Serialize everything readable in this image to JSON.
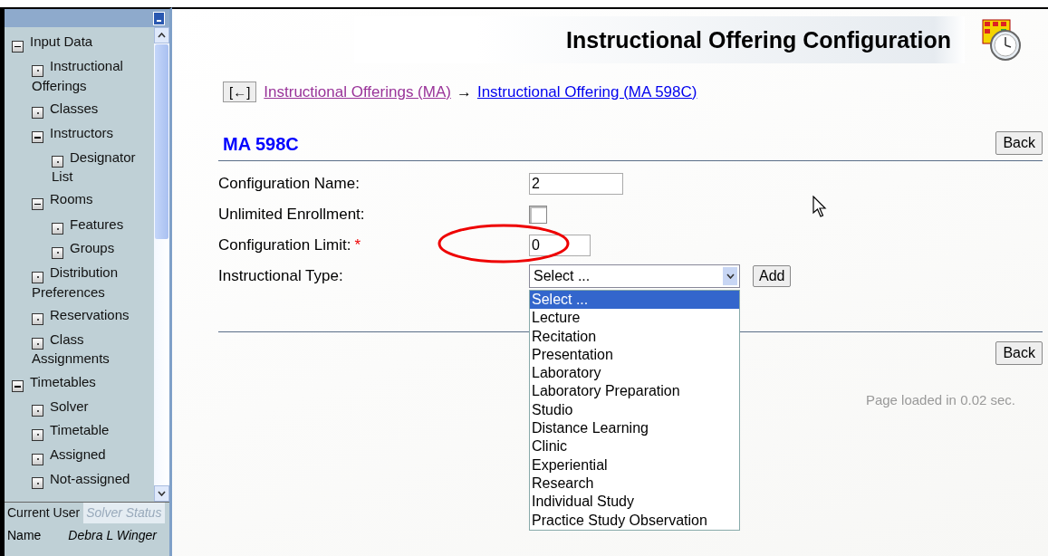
{
  "sidebar": {
    "tree": [
      {
        "label": "Input Data",
        "expanded": true,
        "children": [
          {
            "label": "Instructional Offerings"
          },
          {
            "label": "Classes"
          },
          {
            "label": "Instructors",
            "expanded": true,
            "children": [
              {
                "label": "Designator List"
              }
            ]
          },
          {
            "label": "Rooms",
            "expanded": true,
            "children": [
              {
                "label": "Features"
              },
              {
                "label": "Groups"
              }
            ]
          },
          {
            "label": "Distribution Preferences"
          },
          {
            "label": "Reservations"
          },
          {
            "label": "Class Assignments"
          }
        ]
      },
      {
        "label": "Timetables",
        "expanded": true,
        "children": [
          {
            "label": "Solver"
          },
          {
            "label": "Timetable"
          },
          {
            "label": "Assigned"
          },
          {
            "label": "Not-assigned"
          }
        ]
      }
    ],
    "tabs": [
      {
        "label": "Current User",
        "selected": true
      },
      {
        "label": "Solver Status",
        "selected": false
      }
    ],
    "info": [
      {
        "label": "Name",
        "value": "Debra L Winger"
      }
    ]
  },
  "page": {
    "title": "Instructional Offering Configuration",
    "back_nav": "[←]",
    "breadcrumb": [
      {
        "label": "Instructional Offerings (MA)",
        "visited": true
      },
      {
        "label": "Instructional Offering (MA 598C)",
        "visited": false
      }
    ],
    "breadcrumb_separator": "→",
    "heading": "MA 598C",
    "back_button": "Back",
    "fields": [
      {
        "kind": "text",
        "label": "Configuration Name:",
        "value": "2"
      },
      {
        "kind": "checkbox",
        "label": "Unlimited Enrollment:",
        "checked": false
      },
      {
        "kind": "text",
        "label": "Configuration Limit:",
        "value": "0",
        "required_mark": "*",
        "annotated": true
      },
      {
        "kind": "select",
        "label": "Instructional Type:",
        "value": "Select ...",
        "button": "Add",
        "open": true,
        "options": [
          {
            "label": "Select ...",
            "selected": true
          },
          {
            "label": "Lecture",
            "selected": false
          },
          {
            "label": "Recitation",
            "selected": false
          },
          {
            "label": "Presentation",
            "selected": false
          },
          {
            "label": "Laboratory",
            "selected": false
          },
          {
            "label": "Laboratory Preparation",
            "selected": false
          },
          {
            "label": "Studio",
            "selected": false
          },
          {
            "label": "Distance Learning",
            "selected": false
          },
          {
            "label": "Clinic",
            "selected": false
          },
          {
            "label": "Experiential",
            "selected": false
          },
          {
            "label": "Research",
            "selected": false
          },
          {
            "label": "Individual Study",
            "selected": false
          },
          {
            "label": "Practice Study Observation",
            "selected": false
          }
        ]
      }
    ],
    "bottom_back_button": "Back",
    "footer": "Page loaded in 0.02 sec."
  }
}
